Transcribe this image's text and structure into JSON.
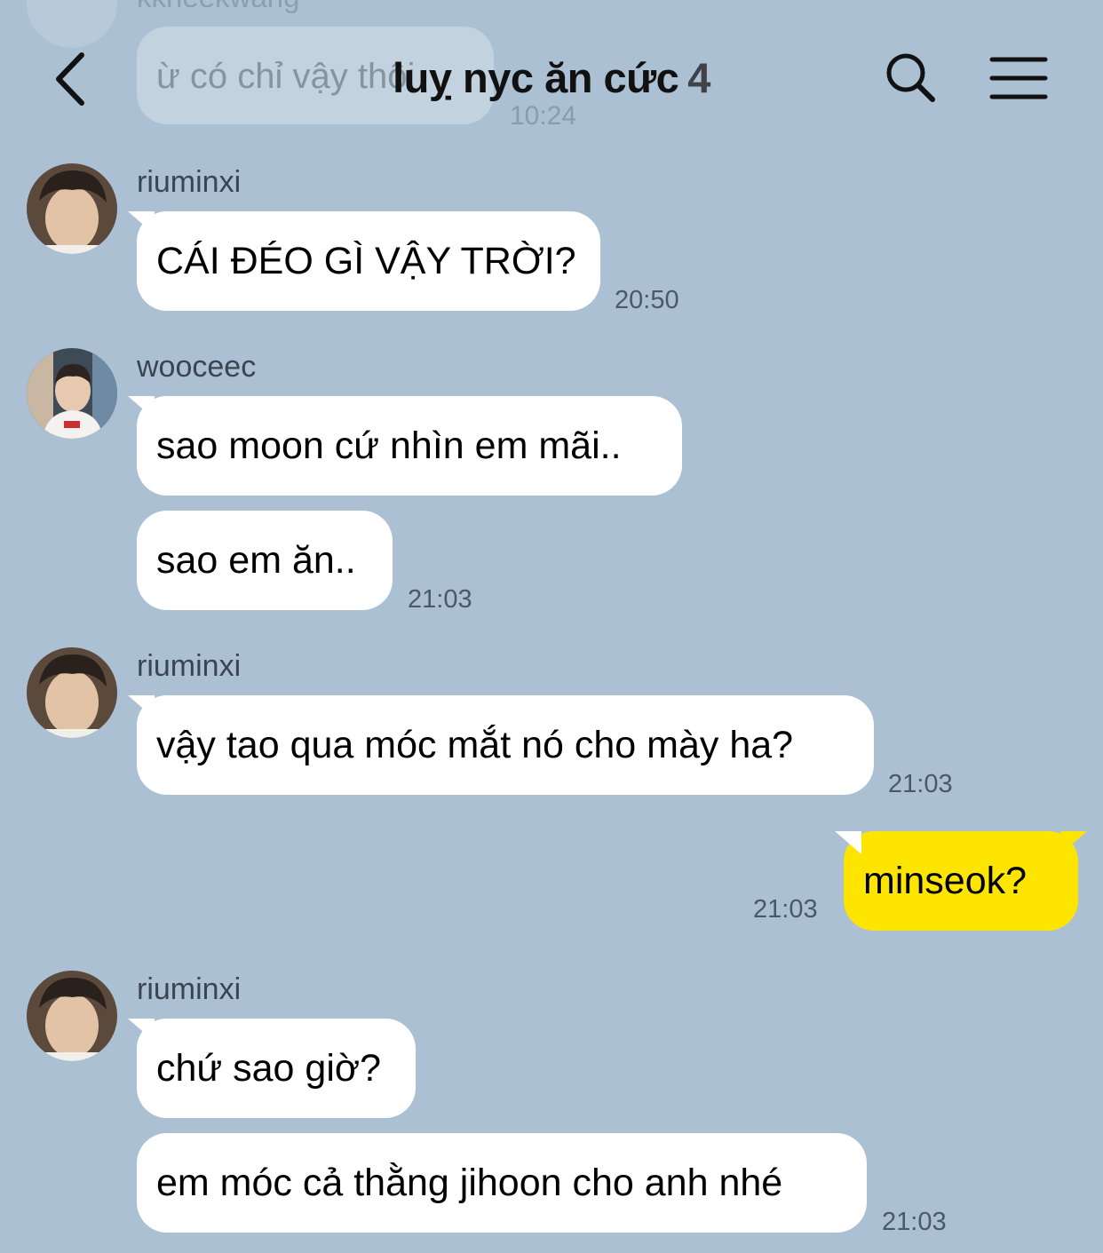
{
  "header": {
    "title": "luỵ nyc ăn cức",
    "member_count": "4",
    "back_icon": "chevron-left-icon",
    "search_icon": "search-icon",
    "menu_icon": "hamburger-menu-icon"
  },
  "previous": {
    "sender": "kkheekwang",
    "text": "ừ có chỉ vậy thôi",
    "time": "10:24"
  },
  "messages": [
    {
      "sender": "riuminxi",
      "texts": [
        "CÁI ĐÉO GÌ VẬY TRỜI?"
      ],
      "time": "20:50"
    },
    {
      "sender": "wooceec",
      "texts": [
        "sao moon cứ nhìn em mãi..",
        "sao em ăn.."
      ],
      "time": "21:03"
    },
    {
      "sender": "riuminxi",
      "texts": [
        "vậy tao qua móc mắt nó cho mày ha?"
      ],
      "time": "21:03"
    },
    {
      "sender": "me",
      "texts": [
        "minseok?"
      ],
      "time": "21:03"
    },
    {
      "sender": "riuminxi",
      "texts": [
        "chứ sao giờ?",
        "em móc cả thằng jihoon cho anh nhé"
      ],
      "time": "21:03"
    }
  ],
  "colors": {
    "background": "#abc1d3",
    "incoming_bubble": "#ffffff",
    "outgoing_bubble": "#fee500"
  }
}
